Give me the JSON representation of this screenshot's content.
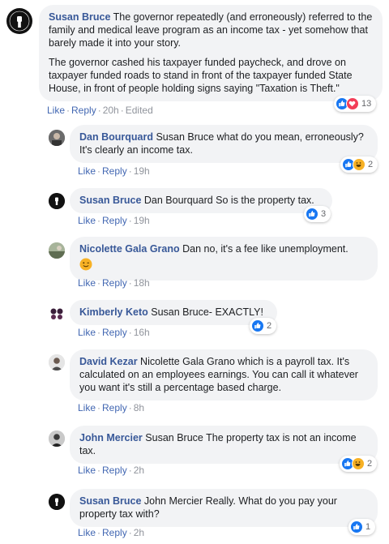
{
  "comments": [
    {
      "author": "Susan Bruce",
      "paragraphs": [
        "The governor repeatedly (and erroneously) referred to the family and medical leave program as an income tax - yet somehow that barely made it into your story.",
        "The governor cashed his taxpayer funded paycheck, and drove on taxpayer funded roads to stand in front of the taxpayer funded State House, in front of people holding signs saying \"Taxation is Theft.\""
      ],
      "like_label": "Like",
      "reply_label": "Reply",
      "time": "20h",
      "edited": "Edited",
      "reaction_count": "13",
      "reactions": [
        "like",
        "love"
      ]
    }
  ],
  "replies": [
    {
      "author": "Dan Bourquard",
      "text": "Susan Bruce what do you mean, erroneously? It's clearly an income tax.",
      "like_label": "Like",
      "reply_label": "Reply",
      "time": "19h",
      "reaction_count": "2",
      "reactions": [
        "like",
        "haha"
      ]
    },
    {
      "author": "Susan Bruce",
      "text": "Dan Bourquard So is the property tax.",
      "like_label": "Like",
      "reply_label": "Reply",
      "time": "19h",
      "reaction_count": "3",
      "reactions": [
        "like"
      ]
    },
    {
      "author": "Nicolette Gala Grano",
      "text": "Dan no, it's a fee like unemployment.",
      "emoji": "wink",
      "like_label": "Like",
      "reply_label": "Reply",
      "time": "18h"
    },
    {
      "author": "Kimberly Keto",
      "text": "Susan Bruce- EXACTLY!",
      "like_label": "Like",
      "reply_label": "Reply",
      "time": "16h",
      "reaction_count": "2",
      "reactions": [
        "like"
      ]
    },
    {
      "author": "David Kezar",
      "text": "Nicolette Gala Grano which is a payroll tax. It's calculated on an employees earnings. You can call it whatever you want it's still a percentage based charge.",
      "like_label": "Like",
      "reply_label": "Reply",
      "time": "8h"
    },
    {
      "author": "John Mercier",
      "text": "Susan Bruce The property tax is not an income tax.",
      "like_label": "Like",
      "reply_label": "Reply",
      "time": "2h",
      "reaction_count": "2",
      "reactions": [
        "like",
        "haha"
      ]
    },
    {
      "author": "Susan Bruce",
      "text": "John Mercier Really. What do you pay your property tax with?",
      "like_label": "Like",
      "reply_label": "Reply",
      "time": "2h",
      "reaction_count": "1",
      "reactions": [
        "like"
      ]
    }
  ],
  "colors": {
    "link": "#385898",
    "action": "#4267b2",
    "bubble": "#f2f3f5",
    "like": "#1877f2",
    "love": "#f33e58",
    "haha": "#f7b125"
  }
}
